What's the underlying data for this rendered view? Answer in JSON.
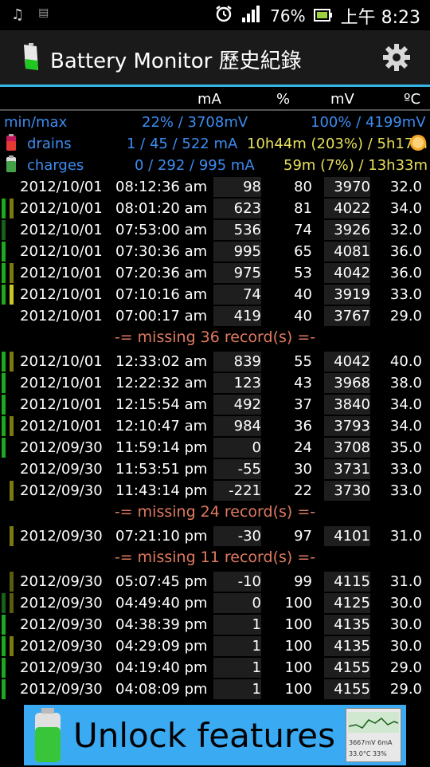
{
  "status_bar": {
    "battery_percent": "76%",
    "time": "上午 8:23"
  },
  "app": {
    "title": "Battery Monitor 歷史紀錄"
  },
  "columns": [
    "mA",
    "%",
    "mV",
    "ºC"
  ],
  "summary": {
    "minmax_label": "min/max",
    "min_value": "22% / 3708mV",
    "max_value": "100% / 4199mV",
    "drains_label": "drains",
    "drains_value": "1 / 45 / 522 mA",
    "drains_time": "10h44m (203%) / 5h17m",
    "charges_label": "charges",
    "charges_value": "0 / 292 / 995 mA",
    "charges_time": "59m (7%) / 13h33m"
  },
  "rows": [
    {
      "date": "2012/10/01",
      "time": "08:12:36 am",
      "ma": "98",
      "pct": "80",
      "mv": "3970",
      "temp": "32.0",
      "bars": []
    },
    {
      "date": "2012/10/01",
      "time": "08:01:20 am",
      "ma": "623",
      "pct": "81",
      "mv": "4022",
      "temp": "34.0",
      "bars": [
        "#1fa81f",
        "#7a7a10"
      ]
    },
    {
      "date": "2012/10/01",
      "time": "07:53:00 am",
      "ma": "536",
      "pct": "74",
      "mv": "3926",
      "temp": "32.0",
      "bars": [
        "#1a5f1a"
      ]
    },
    {
      "date": "2012/10/01",
      "time": "07:30:36 am",
      "ma": "995",
      "pct": "65",
      "mv": "4081",
      "temp": "36.0",
      "bars": [
        "#1fa81f"
      ]
    },
    {
      "date": "2012/10/01",
      "time": "07:20:36 am",
      "ma": "975",
      "pct": "53",
      "mv": "4042",
      "temp": "36.0",
      "bars": [
        "#1fa81f",
        "#7a7a10"
      ]
    },
    {
      "date": "2012/10/01",
      "time": "07:10:16 am",
      "ma": "74",
      "pct": "40",
      "mv": "3919",
      "temp": "33.0",
      "bars": [
        "#1fa81f",
        "#c8c820"
      ]
    },
    {
      "date": "2012/10/01",
      "time": "07:00:17 am",
      "ma": "419",
      "pct": "40",
      "mv": "3767",
      "temp": "29.0",
      "bars": []
    }
  ],
  "missing_1": "-= missing 36 record(s) =-",
  "rows2": [
    {
      "date": "2012/10/01",
      "time": "12:33:02 am",
      "ma": "839",
      "pct": "55",
      "mv": "4042",
      "temp": "40.0",
      "bars": [
        "#1fa81f",
        "#7a7a10"
      ]
    },
    {
      "date": "2012/10/01",
      "time": "12:22:32 am",
      "ma": "123",
      "pct": "43",
      "mv": "3968",
      "temp": "38.0",
      "bars": [
        "#1fa81f"
      ]
    },
    {
      "date": "2012/10/01",
      "time": "12:15:54 am",
      "ma": "492",
      "pct": "37",
      "mv": "3840",
      "temp": "34.0",
      "bars": [
        "#1fa81f"
      ]
    },
    {
      "date": "2012/10/01",
      "time": "12:10:47 am",
      "ma": "984",
      "pct": "36",
      "mv": "3793",
      "temp": "34.0",
      "bars": [
        "#1fa81f",
        "#7a7a10"
      ]
    },
    {
      "date": "2012/09/30",
      "time": "11:59:14 pm",
      "ma": "0",
      "pct": "24",
      "mv": "3708",
      "temp": "35.0",
      "bars": [
        "#1fa81f"
      ]
    },
    {
      "date": "2012/09/30",
      "time": "11:53:51 pm",
      "ma": "-55",
      "pct": "30",
      "mv": "3731",
      "temp": "33.0",
      "bars": []
    },
    {
      "date": "2012/09/30",
      "time": "11:43:14 pm",
      "ma": "-221",
      "pct": "22",
      "mv": "3730",
      "temp": "33.0",
      "bars": [
        "",
        "#7a7a10"
      ]
    }
  ],
  "missing_2": "-= missing 24 record(s) =-",
  "rows3": [
    {
      "date": "2012/09/30",
      "time": "07:21:10 pm",
      "ma": "-30",
      "pct": "97",
      "mv": "4101",
      "temp": "31.0",
      "bars": [
        "",
        "#7a7a10"
      ]
    }
  ],
  "missing_3": "-= missing 11 record(s) =-",
  "rows4": [
    {
      "date": "2012/09/30",
      "time": "05:07:45 pm",
      "ma": "-10",
      "pct": "99",
      "mv": "4115",
      "temp": "31.0",
      "bars": [
        "",
        "#5a5a10"
      ]
    },
    {
      "date": "2012/09/30",
      "time": "04:49:40 pm",
      "ma": "0",
      "pct": "100",
      "mv": "4125",
      "temp": "30.0",
      "bars": [
        "#1a5f1a",
        "#5a5a10"
      ]
    },
    {
      "date": "2012/09/30",
      "time": "04:38:39 pm",
      "ma": "1",
      "pct": "100",
      "mv": "4135",
      "temp": "30.0",
      "bars": [
        "#1fa81f"
      ]
    },
    {
      "date": "2012/09/30",
      "time": "04:29:09 pm",
      "ma": "1",
      "pct": "100",
      "mv": "4135",
      "temp": "30.0",
      "bars": [
        "#1fa81f",
        "#7a7a10"
      ]
    },
    {
      "date": "2012/09/30",
      "time": "04:19:40 pm",
      "ma": "1",
      "pct": "100",
      "mv": "4155",
      "temp": "29.0",
      "bars": [
        "#1fa81f"
      ]
    },
    {
      "date": "2012/09/30",
      "time": "04:08:09 pm",
      "ma": "1",
      "pct": "100",
      "mv": "4155",
      "temp": "29.0",
      "bars": [
        "#1fa81f"
      ]
    }
  ],
  "ad": {
    "text": "Unlock features",
    "thumb_line1": "3667mV 6mA",
    "thumb_line2": "33.0°C 33%"
  },
  "colors": {
    "accent": "#33b5e5",
    "summary_blue": "#3d8cf0",
    "summary_yellow": "#e8e05a",
    "missing": "#e07a5f"
  }
}
